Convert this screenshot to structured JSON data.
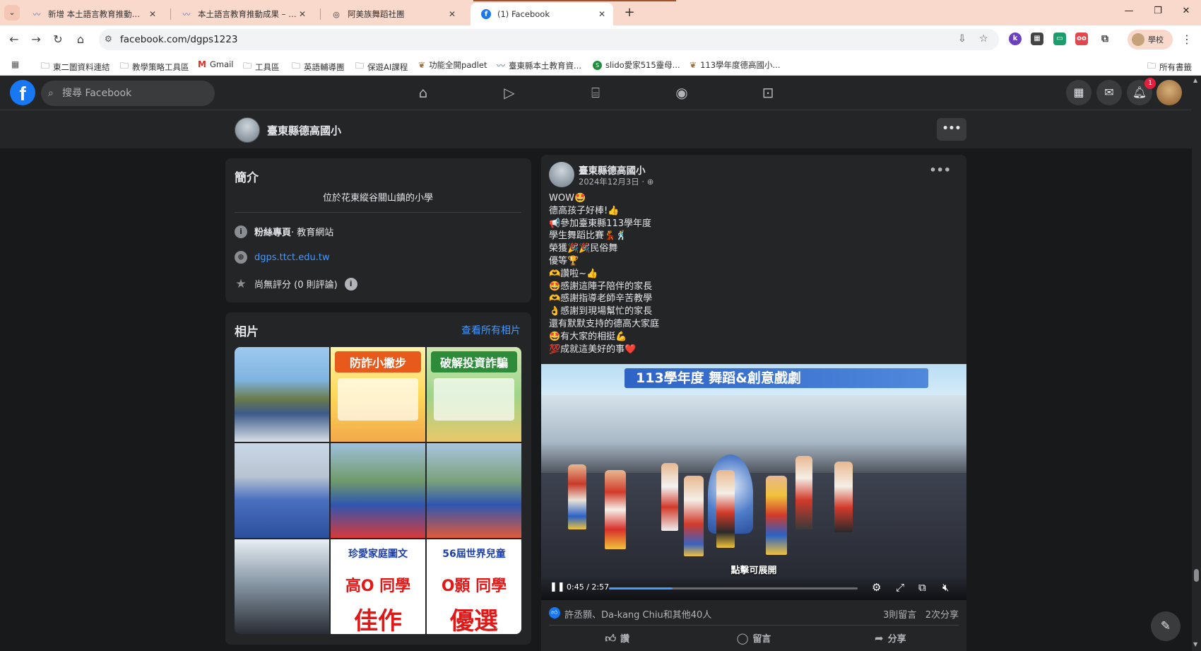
{
  "browser": {
    "tabs": [
      {
        "label": "新增 本土語言教育推動成果 ‹ 臺",
        "active": false
      },
      {
        "label": "本土語言教育推動成果 – 臺東縣",
        "active": false
      },
      {
        "label": "阿美族舞蹈社團",
        "active": false
      },
      {
        "label": "(1) Facebook",
        "active": true
      }
    ],
    "new_tab": "+",
    "url": "facebook.com/dgps1223",
    "profile_label": "學校",
    "bookmarks": [
      {
        "label": "東二圖資料連結",
        "icon": "folder-icon"
      },
      {
        "label": "教學策略工具區",
        "icon": "folder-icon"
      },
      {
        "label": "Gmail",
        "icon": "gmail-icon"
      },
      {
        "label": "工具區",
        "icon": "folder-icon"
      },
      {
        "label": "英語輔導團",
        "icon": "folder-icon"
      },
      {
        "label": "保遊AI課程",
        "icon": "folder-icon"
      },
      {
        "label": "功能全開padlet",
        "icon": "padlet-icon"
      },
      {
        "label": "臺東縣本土教育資...",
        "icon": "site-icon"
      },
      {
        "label": "slido愛家515靈母...",
        "icon": "slido-icon"
      },
      {
        "label": "113學年度德高國小...",
        "icon": "padlet-icon"
      }
    ],
    "all_bookmarks": "所有書籤"
  },
  "fb": {
    "search_placeholder": "搜尋 Facebook",
    "notif_count": "1",
    "page_name": "臺東縣德高國小",
    "intro": {
      "title": "簡介",
      "bio": "位於花東縱谷關山鎮的小學",
      "category_label": "粉絲專頁",
      "category_value": " · 教育網站",
      "website": "dgps.ttct.edu.tw",
      "rating": "尚無評分 (0 則評論)"
    },
    "photos": {
      "title": "相片",
      "see_all": "查看所有相片",
      "poster2_title": "防詐小撇步",
      "poster3_title": "破解投資詐騙",
      "poster8": {
        "top": "珍愛家庭圖文",
        "mid": "高O 同學",
        "bot": "佳作"
      },
      "poster9": {
        "top": "56屆世界兒童",
        "mid": "O顥 同學",
        "bot": "優選"
      }
    },
    "post": {
      "author": "臺東縣德高國小",
      "date": "2024年12月3日 · ",
      "privacy_icon": "globe-icon",
      "lines": [
        "WOW🤩",
        "德高孩子好棒!👍",
        "📢參加臺東縣113學年度",
        "學生舞蹈比賽💃🕺",
        "榮獲🎉🎉民俗舞",
        "優等🏆",
        "🫶讚啦~👍",
        "🤩感謝這陣子陪伴的家長",
        "🫶感謝指導老師辛苦教學",
        "👌感謝到現場幫忙的家長",
        "還有默默支持的德高大家庭",
        "🤩有大家的相挺💪",
        "💯成就這美好的事❤️"
      ],
      "video": {
        "banner": "113學年度  舞蹈&創意戲劇",
        "tap_hint": "點擊可展開",
        "time": "0:45 / 2:57",
        "progress": 0.255
      },
      "reactions": "許丞顥、Da-kang Chiu和其他40人",
      "comments": "3則留言",
      "shares": "2次分享",
      "actions": {
        "like": "讚",
        "comment": "留言",
        "share": "分享"
      }
    }
  }
}
